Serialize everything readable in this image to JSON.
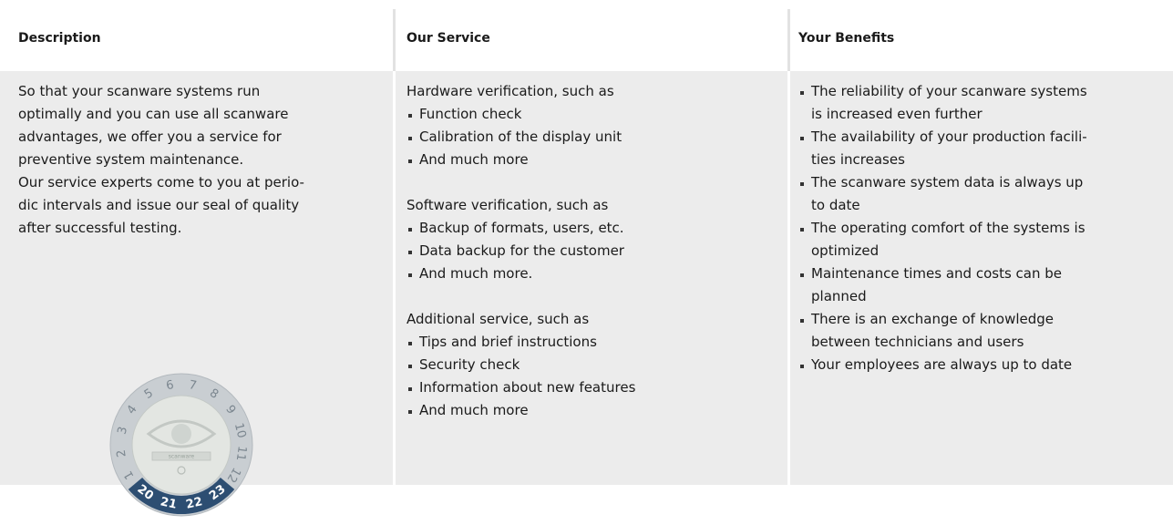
{
  "headers": {
    "description": "Description",
    "service": "Our Service",
    "benefits": "Your Benefits"
  },
  "description": {
    "lines": [
      "So that your scanware systems run",
      "optimally and you can use all scanware",
      "advantages, we offer you a service for",
      "preventive system maintenance.",
      "Our service experts come to you at perio-",
      "dic intervals and issue our seal of quality",
      "after successful testing."
    ]
  },
  "seal": {
    "months": [
      "1",
      "2",
      "3",
      "4",
      "5",
      "6",
      "7",
      "8",
      "9",
      "10",
      "11",
      "12"
    ],
    "years": [
      "20",
      "21",
      "22",
      "23"
    ],
    "brand_text": "scanware",
    "ring_color": "#c9ced2",
    "face_color": "#e3e6e2",
    "year_band_color": "#2d4e72"
  },
  "service": {
    "hardware": {
      "intro": "Hardware verification, such as",
      "items": [
        "Function check",
        "Calibration of the display unit",
        "And much more"
      ]
    },
    "software": {
      "intro": "Software verification, such as",
      "items": [
        "Backup of formats, users, etc.",
        "Data backup for the customer",
        "And much more."
      ]
    },
    "additional": {
      "intro": "Additional service, such as",
      "items": [
        "Tips and brief instructions",
        "Security check",
        "Information about new features",
        "And much more"
      ]
    }
  },
  "benefits": {
    "items": [
      [
        "The reliability of your scanware systems",
        "is increased even further"
      ],
      [
        "The availability of your production facili-",
        "ties increases"
      ],
      [
        "The scanware system data is always up",
        "to date"
      ],
      [
        "The operating comfort of the systems is",
        "optimized"
      ],
      [
        "Maintenance times and costs can be",
        "planned"
      ],
      [
        "There is an exchange of knowledge",
        "between technicians and users"
      ],
      [
        "Your employees are always up to date"
      ]
    ]
  }
}
